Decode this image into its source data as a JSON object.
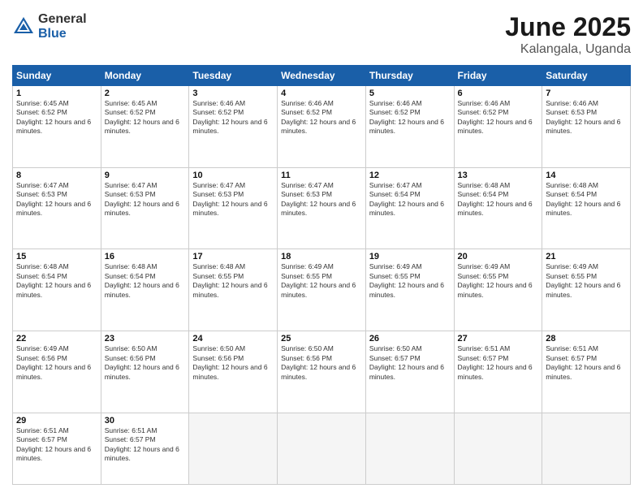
{
  "logo": {
    "general": "General",
    "blue": "Blue"
  },
  "title": "June 2025",
  "subtitle": "Kalangala, Uganda",
  "days_of_week": [
    "Sunday",
    "Monday",
    "Tuesday",
    "Wednesday",
    "Thursday",
    "Friday",
    "Saturday"
  ],
  "weeks": [
    [
      {
        "num": "1",
        "sunrise": "Sunrise: 6:45 AM",
        "sunset": "Sunset: 6:52 PM",
        "daylight": "Daylight: 12 hours and 6 minutes."
      },
      {
        "num": "2",
        "sunrise": "Sunrise: 6:45 AM",
        "sunset": "Sunset: 6:52 PM",
        "daylight": "Daylight: 12 hours and 6 minutes."
      },
      {
        "num": "3",
        "sunrise": "Sunrise: 6:46 AM",
        "sunset": "Sunset: 6:52 PM",
        "daylight": "Daylight: 12 hours and 6 minutes."
      },
      {
        "num": "4",
        "sunrise": "Sunrise: 6:46 AM",
        "sunset": "Sunset: 6:52 PM",
        "daylight": "Daylight: 12 hours and 6 minutes."
      },
      {
        "num": "5",
        "sunrise": "Sunrise: 6:46 AM",
        "sunset": "Sunset: 6:52 PM",
        "daylight": "Daylight: 12 hours and 6 minutes."
      },
      {
        "num": "6",
        "sunrise": "Sunrise: 6:46 AM",
        "sunset": "Sunset: 6:52 PM",
        "daylight": "Daylight: 12 hours and 6 minutes."
      },
      {
        "num": "7",
        "sunrise": "Sunrise: 6:46 AM",
        "sunset": "Sunset: 6:53 PM",
        "daylight": "Daylight: 12 hours and 6 minutes."
      }
    ],
    [
      {
        "num": "8",
        "sunrise": "Sunrise: 6:47 AM",
        "sunset": "Sunset: 6:53 PM",
        "daylight": "Daylight: 12 hours and 6 minutes."
      },
      {
        "num": "9",
        "sunrise": "Sunrise: 6:47 AM",
        "sunset": "Sunset: 6:53 PM",
        "daylight": "Daylight: 12 hours and 6 minutes."
      },
      {
        "num": "10",
        "sunrise": "Sunrise: 6:47 AM",
        "sunset": "Sunset: 6:53 PM",
        "daylight": "Daylight: 12 hours and 6 minutes."
      },
      {
        "num": "11",
        "sunrise": "Sunrise: 6:47 AM",
        "sunset": "Sunset: 6:53 PM",
        "daylight": "Daylight: 12 hours and 6 minutes."
      },
      {
        "num": "12",
        "sunrise": "Sunrise: 6:47 AM",
        "sunset": "Sunset: 6:54 PM",
        "daylight": "Daylight: 12 hours and 6 minutes."
      },
      {
        "num": "13",
        "sunrise": "Sunrise: 6:48 AM",
        "sunset": "Sunset: 6:54 PM",
        "daylight": "Daylight: 12 hours and 6 minutes."
      },
      {
        "num": "14",
        "sunrise": "Sunrise: 6:48 AM",
        "sunset": "Sunset: 6:54 PM",
        "daylight": "Daylight: 12 hours and 6 minutes."
      }
    ],
    [
      {
        "num": "15",
        "sunrise": "Sunrise: 6:48 AM",
        "sunset": "Sunset: 6:54 PM",
        "daylight": "Daylight: 12 hours and 6 minutes."
      },
      {
        "num": "16",
        "sunrise": "Sunrise: 6:48 AM",
        "sunset": "Sunset: 6:54 PM",
        "daylight": "Daylight: 12 hours and 6 minutes."
      },
      {
        "num": "17",
        "sunrise": "Sunrise: 6:48 AM",
        "sunset": "Sunset: 6:55 PM",
        "daylight": "Daylight: 12 hours and 6 minutes."
      },
      {
        "num": "18",
        "sunrise": "Sunrise: 6:49 AM",
        "sunset": "Sunset: 6:55 PM",
        "daylight": "Daylight: 12 hours and 6 minutes."
      },
      {
        "num": "19",
        "sunrise": "Sunrise: 6:49 AM",
        "sunset": "Sunset: 6:55 PM",
        "daylight": "Daylight: 12 hours and 6 minutes."
      },
      {
        "num": "20",
        "sunrise": "Sunrise: 6:49 AM",
        "sunset": "Sunset: 6:55 PM",
        "daylight": "Daylight: 12 hours and 6 minutes."
      },
      {
        "num": "21",
        "sunrise": "Sunrise: 6:49 AM",
        "sunset": "Sunset: 6:55 PM",
        "daylight": "Daylight: 12 hours and 6 minutes."
      }
    ],
    [
      {
        "num": "22",
        "sunrise": "Sunrise: 6:49 AM",
        "sunset": "Sunset: 6:56 PM",
        "daylight": "Daylight: 12 hours and 6 minutes."
      },
      {
        "num": "23",
        "sunrise": "Sunrise: 6:50 AM",
        "sunset": "Sunset: 6:56 PM",
        "daylight": "Daylight: 12 hours and 6 minutes."
      },
      {
        "num": "24",
        "sunrise": "Sunrise: 6:50 AM",
        "sunset": "Sunset: 6:56 PM",
        "daylight": "Daylight: 12 hours and 6 minutes."
      },
      {
        "num": "25",
        "sunrise": "Sunrise: 6:50 AM",
        "sunset": "Sunset: 6:56 PM",
        "daylight": "Daylight: 12 hours and 6 minutes."
      },
      {
        "num": "26",
        "sunrise": "Sunrise: 6:50 AM",
        "sunset": "Sunset: 6:57 PM",
        "daylight": "Daylight: 12 hours and 6 minutes."
      },
      {
        "num": "27",
        "sunrise": "Sunrise: 6:51 AM",
        "sunset": "Sunset: 6:57 PM",
        "daylight": "Daylight: 12 hours and 6 minutes."
      },
      {
        "num": "28",
        "sunrise": "Sunrise: 6:51 AM",
        "sunset": "Sunset: 6:57 PM",
        "daylight": "Daylight: 12 hours and 6 minutes."
      }
    ],
    [
      {
        "num": "29",
        "sunrise": "Sunrise: 6:51 AM",
        "sunset": "Sunset: 6:57 PM",
        "daylight": "Daylight: 12 hours and 6 minutes."
      },
      {
        "num": "30",
        "sunrise": "Sunrise: 6:51 AM",
        "sunset": "Sunset: 6:57 PM",
        "daylight": "Daylight: 12 hours and 6 minutes."
      },
      null,
      null,
      null,
      null,
      null
    ]
  ]
}
